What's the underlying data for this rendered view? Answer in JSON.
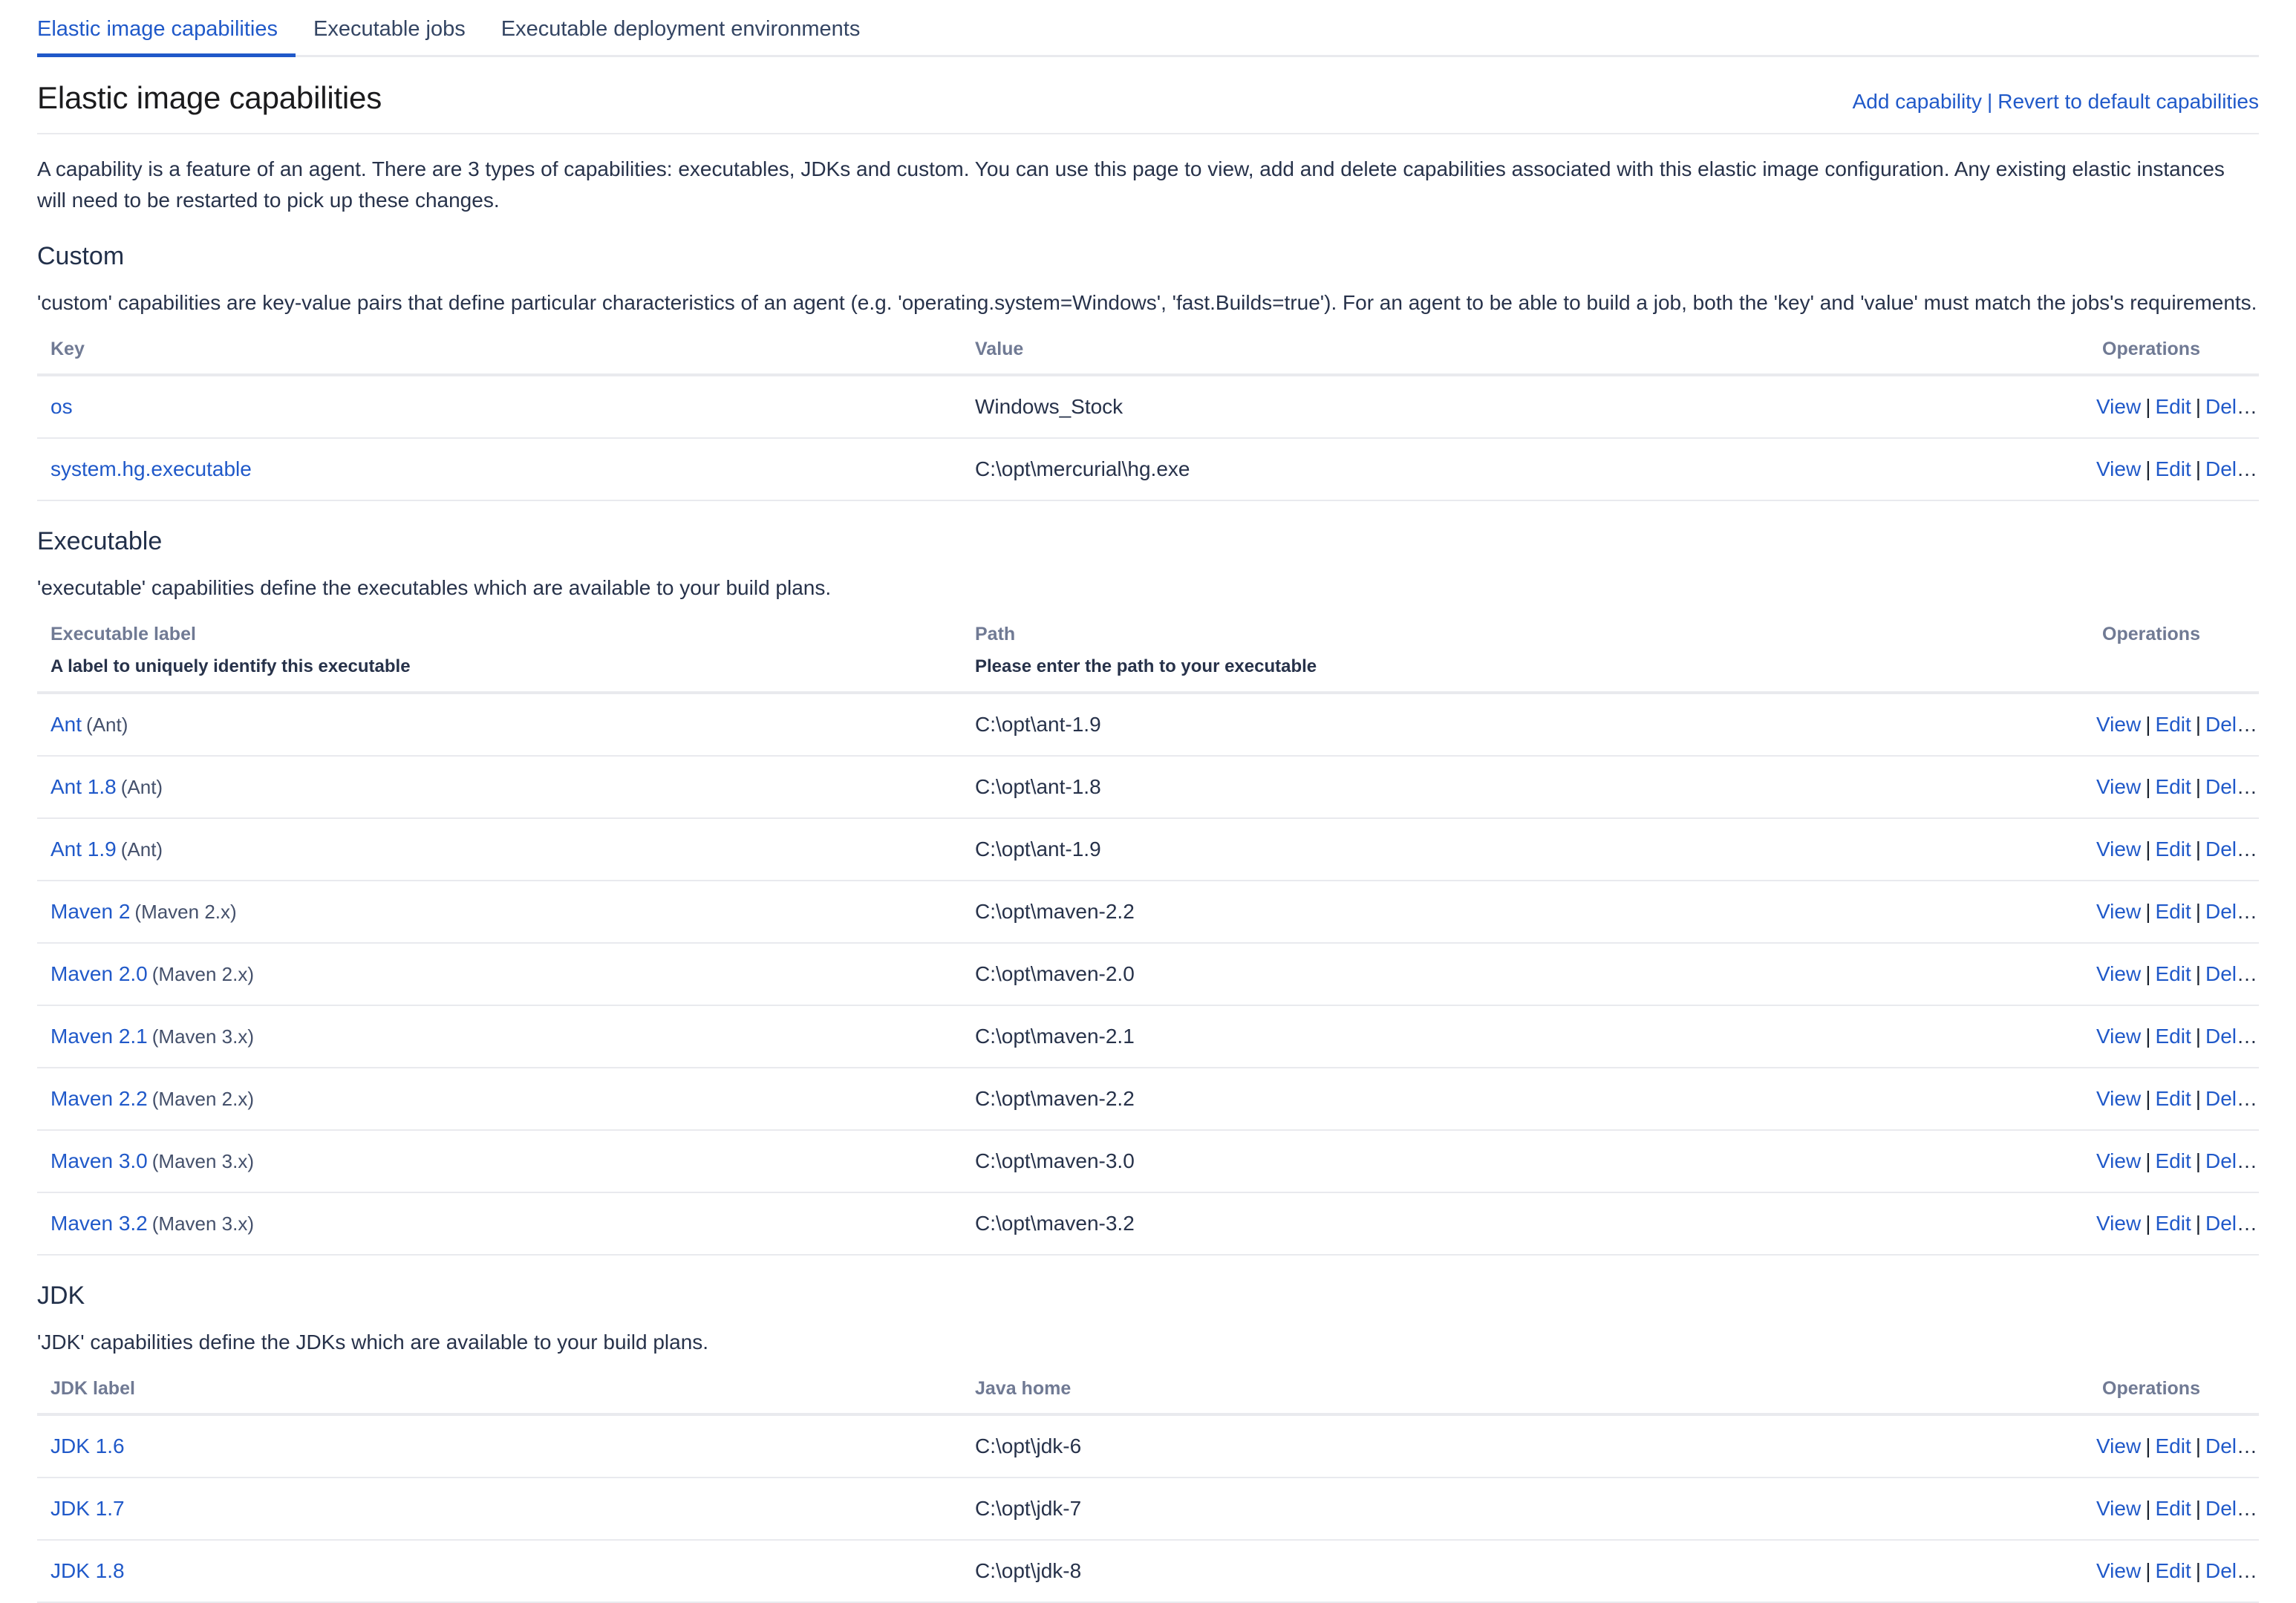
{
  "tabs": [
    {
      "label": "Elastic image capabilities",
      "active": true
    },
    {
      "label": "Executable jobs",
      "active": false
    },
    {
      "label": "Executable deployment environments",
      "active": false
    }
  ],
  "header": {
    "title": "Elastic image capabilities",
    "add_capability_label": "Add capability",
    "separator": "|",
    "revert_label": "Revert to default capabilities"
  },
  "intro": "A capability is a feature of an agent. There are 3 types of capabilities: executables, JDKs and custom. You can use this page to view, add and delete capabilities associated with this elastic image configuration. Any existing elastic instances will need to be restarted to pick up these changes.",
  "ops": {
    "view": "View",
    "edit": "Edit",
    "delete": "Delete",
    "bar": "|"
  },
  "custom": {
    "title": "Custom",
    "description": "'custom' capabilities are key-value pairs that define particular characteristics of an agent (e.g. 'operating.system=Windows', 'fast.Builds=true'). For an agent to be able to build a job, both the 'key' and 'value' must match the jobs's requirements.",
    "columns": {
      "key": "Key",
      "value": "Value",
      "operations": "Operations"
    },
    "rows": [
      {
        "key": "os",
        "value": "Windows_Stock"
      },
      {
        "key": "system.hg.executable",
        "value": "C:\\opt\\mercurial\\hg.exe"
      }
    ]
  },
  "executable": {
    "title": "Executable",
    "description": "'executable' capabilities define the executables which are available to your build plans.",
    "columns": {
      "label": "Executable label",
      "label_sub": "A label to uniquely identify this executable",
      "path": "Path",
      "path_sub": "Please enter the path to your executable",
      "operations": "Operations"
    },
    "rows": [
      {
        "label": "Ant",
        "type": "(Ant)",
        "path": "C:\\opt\\ant-1.9"
      },
      {
        "label": "Ant 1.8",
        "type": "(Ant)",
        "path": "C:\\opt\\ant-1.8"
      },
      {
        "label": "Ant 1.9",
        "type": "(Ant)",
        "path": "C:\\opt\\ant-1.9"
      },
      {
        "label": "Maven 2",
        "type": "(Maven 2.x)",
        "path": "C:\\opt\\maven-2.2"
      },
      {
        "label": "Maven 2.0",
        "type": "(Maven 2.x)",
        "path": "C:\\opt\\maven-2.0"
      },
      {
        "label": "Maven 2.1",
        "type": "(Maven 3.x)",
        "path": "C:\\opt\\maven-2.1"
      },
      {
        "label": "Maven 2.2",
        "type": "(Maven 2.x)",
        "path": "C:\\opt\\maven-2.2"
      },
      {
        "label": "Maven 3.0",
        "type": "(Maven 3.x)",
        "path": "C:\\opt\\maven-3.0"
      },
      {
        "label": "Maven 3.2",
        "type": "(Maven 3.x)",
        "path": "C:\\opt\\maven-3.2"
      }
    ]
  },
  "jdk": {
    "title": "JDK",
    "description": "'JDK' capabilities define the JDKs which are available to your build plans.",
    "columns": {
      "label": "JDK label",
      "java_home": "Java home",
      "operations": "Operations"
    },
    "rows": [
      {
        "label": "JDK 1.6",
        "java_home": "C:\\opt\\jdk-6"
      },
      {
        "label": "JDK 1.7",
        "java_home": "C:\\opt\\jdk-7"
      },
      {
        "label": "JDK 1.8",
        "java_home": "C:\\opt\\jdk-8"
      }
    ]
  },
  "colors": {
    "link": "#2059c9",
    "text": "#27324a",
    "muted_header": "#707a94",
    "rule": "#e9eaee",
    "title": "#1b1b1d"
  }
}
